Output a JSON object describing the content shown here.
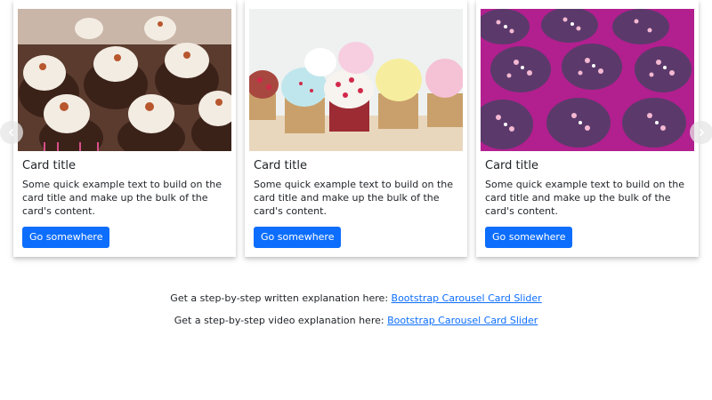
{
  "cards": [
    {
      "image": "chocolate-cupcakes-with-bacon",
      "title": "Card title",
      "text": "Some quick example text to build on the card title and make up the bulk of the card's content.",
      "button": "Go somewhere"
    },
    {
      "image": "pastel-sprinkle-cupcakes",
      "title": "Card title",
      "text": "Some quick example text to build on the card title and make up the bulk of the card's content.",
      "button": "Go somewhere"
    },
    {
      "image": "purple-heart-sprinkle-cupcakes",
      "title": "Card title",
      "text": "Some quick example text to build on the card title and make up the bulk of the card's content.",
      "button": "Go somewhere"
    }
  ],
  "carousel": {
    "prev_icon": "chevron-left-icon",
    "next_icon": "chevron-right-icon"
  },
  "links": [
    {
      "prefix": "Get a step-by-step written explanation here:",
      "link_text": "Bootstrap Carousel Card Slider"
    },
    {
      "prefix": "Get a step-by-step video explanation here:",
      "link_text": "Bootstrap Carousel Card Slider"
    }
  ],
  "colors": {
    "button": "#0d6efd",
    "link": "#0d6efd",
    "text": "#212529"
  }
}
